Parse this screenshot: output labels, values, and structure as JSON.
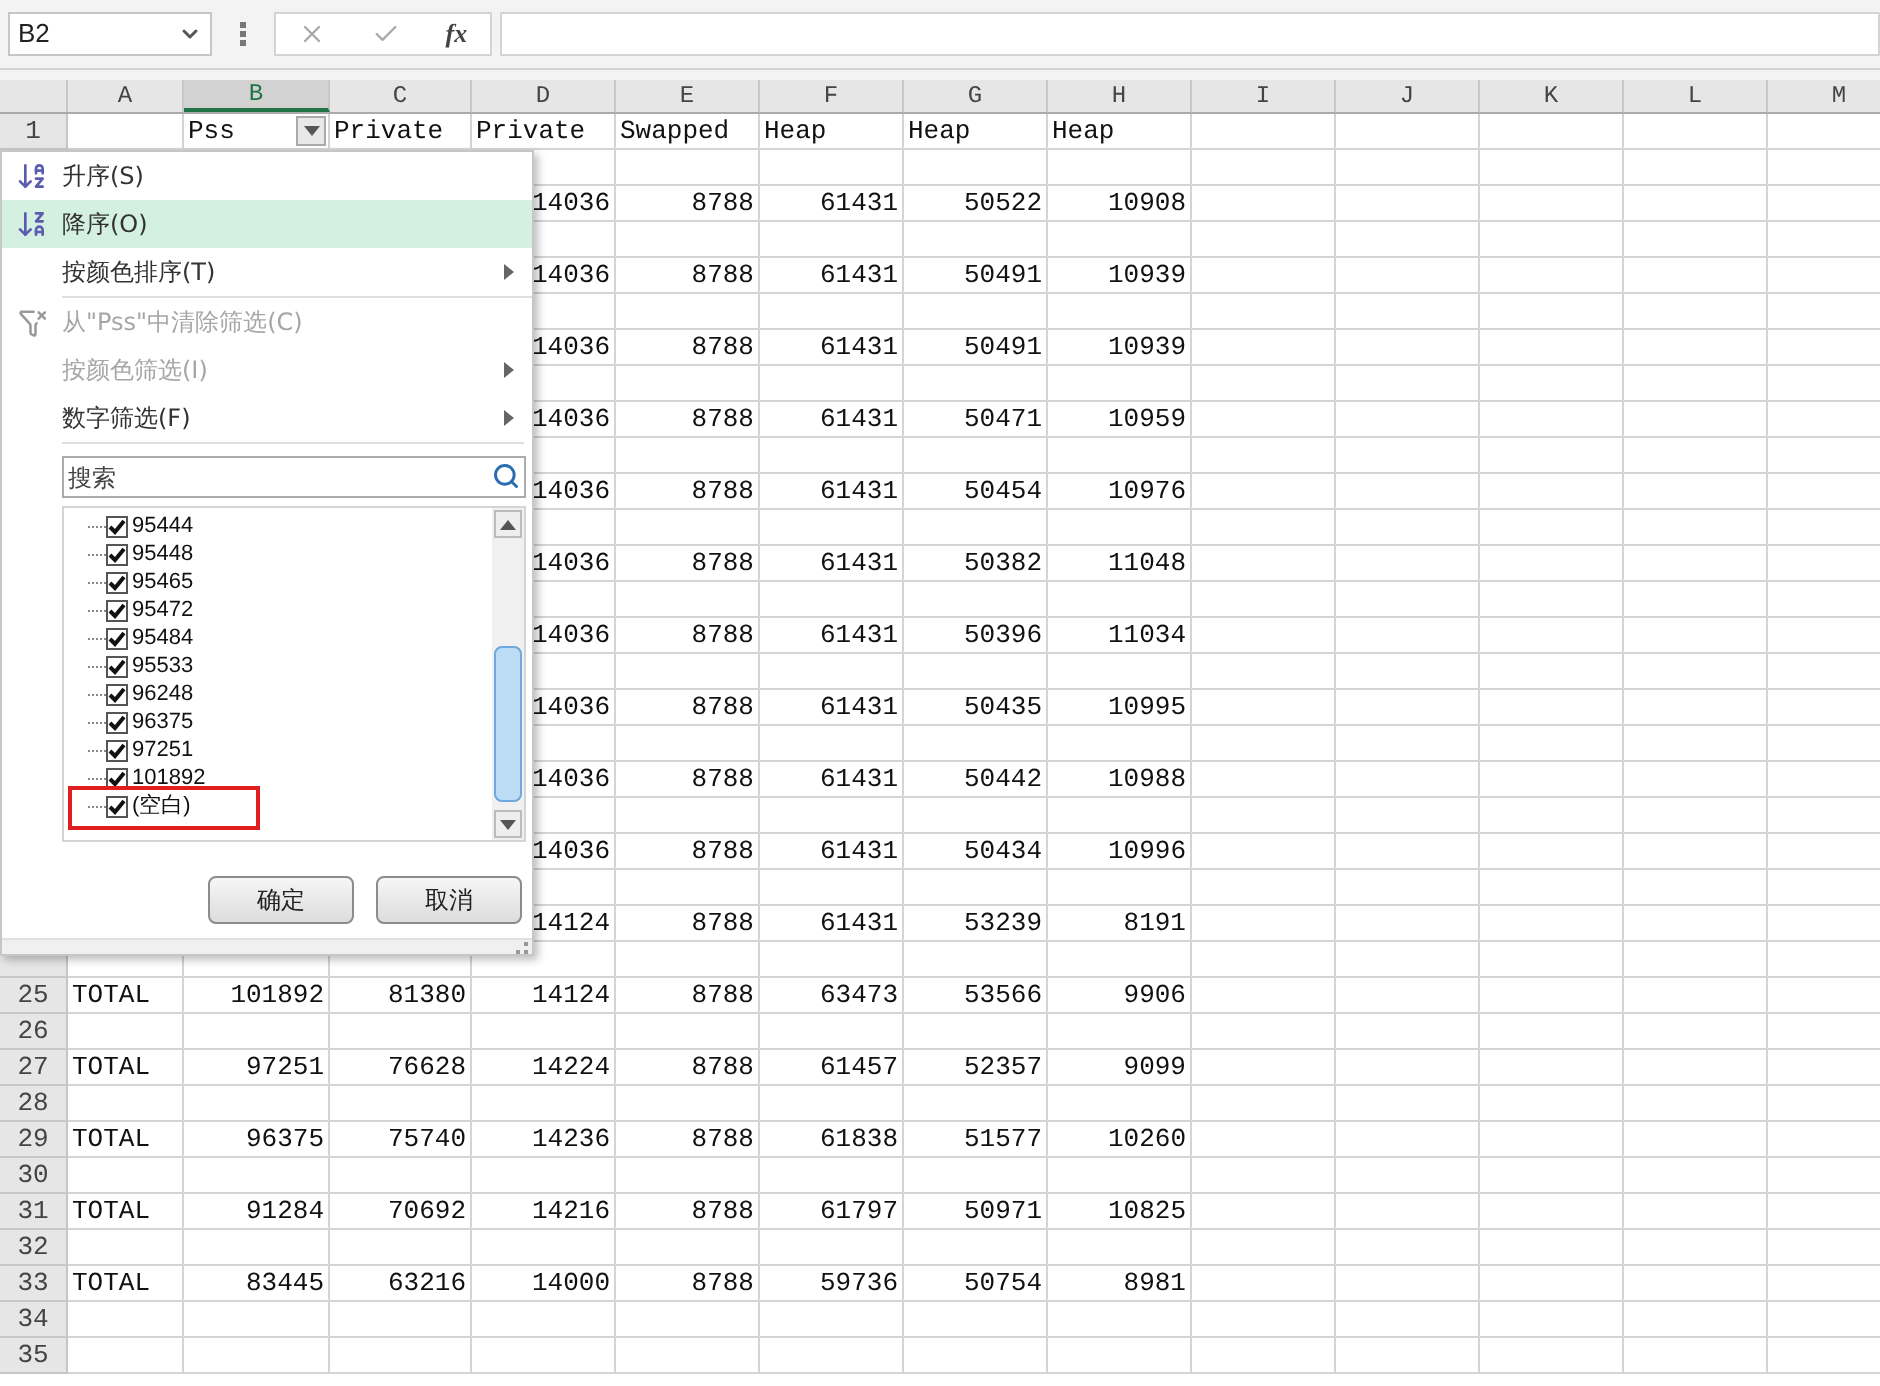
{
  "formula_bar": {
    "name_box": "B2",
    "function_label": "fx"
  },
  "sheet": {
    "columns": [
      {
        "letter": "A",
        "selected": false,
        "filter": false
      },
      {
        "letter": "B",
        "selected": true,
        "filter": true
      },
      {
        "letter": "C",
        "selected": false,
        "filter": false
      },
      {
        "letter": "D",
        "selected": false,
        "filter": false
      },
      {
        "letter": "E",
        "selected": false,
        "filter": false
      },
      {
        "letter": "F",
        "selected": false,
        "filter": false
      },
      {
        "letter": "G",
        "selected": false,
        "filter": false
      },
      {
        "letter": "H",
        "selected": false,
        "filter": false
      },
      {
        "letter": "I",
        "selected": false,
        "filter": false
      },
      {
        "letter": "J",
        "selected": false,
        "filter": false
      },
      {
        "letter": "K",
        "selected": false,
        "filter": false
      },
      {
        "letter": "L",
        "selected": false,
        "filter": false
      },
      {
        "letter": "M",
        "selected": false,
        "filter": false
      }
    ],
    "rows": [
      {
        "num": "1",
        "kind": "labels",
        "cells": {
          "B": "Pss",
          "C": "Private",
          "D": "Private",
          "E": "Swapped",
          "F": "Heap",
          "G": "Heap",
          "H": "Heap"
        }
      },
      {},
      {
        "cells": {
          "D": "14036",
          "E": "8788",
          "F": "61431",
          "G": "50522",
          "H": "10908"
        }
      },
      {},
      {
        "cells": {
          "D": "14036",
          "E": "8788",
          "F": "61431",
          "G": "50491",
          "H": "10939"
        }
      },
      {},
      {
        "cells": {
          "D": "14036",
          "E": "8788",
          "F": "61431",
          "G": "50491",
          "H": "10939"
        }
      },
      {},
      {
        "cells": {
          "D": "14036",
          "E": "8788",
          "F": "61431",
          "G": "50471",
          "H": "10959"
        }
      },
      {},
      {
        "cells": {
          "D": "14036",
          "E": "8788",
          "F": "61431",
          "G": "50454",
          "H": "10976"
        }
      },
      {},
      {
        "cells": {
          "D": "14036",
          "E": "8788",
          "F": "61431",
          "G": "50382",
          "H": "11048"
        }
      },
      {},
      {
        "cells": {
          "D": "14036",
          "E": "8788",
          "F": "61431",
          "G": "50396",
          "H": "11034"
        }
      },
      {},
      {
        "cells": {
          "D": "14036",
          "E": "8788",
          "F": "61431",
          "G": "50435",
          "H": "10995"
        }
      },
      {},
      {
        "cells": {
          "D": "14036",
          "E": "8788",
          "F": "61431",
          "G": "50442",
          "H": "10988"
        }
      },
      {},
      {
        "cells": {
          "D": "14036",
          "E": "8788",
          "F": "61431",
          "G": "50434",
          "H": "10996"
        }
      },
      {},
      {
        "cells": {
          "D": "14124",
          "E": "8788",
          "F": "61431",
          "G": "53239",
          "H": "8191"
        }
      },
      {},
      {
        "num": "25",
        "cells": {
          "A": "TOTAL",
          "B": "101892",
          "C": "81380",
          "D": "14124",
          "E": "8788",
          "F": "63473",
          "G": "53566",
          "H": "9906"
        }
      },
      {
        "num": "26"
      },
      {
        "num": "27",
        "cells": {
          "A": "TOTAL",
          "B": "97251",
          "C": "76628",
          "D": "14224",
          "E": "8788",
          "F": "61457",
          "G": "52357",
          "H": "9099"
        }
      },
      {
        "num": "28"
      },
      {
        "num": "29",
        "cells": {
          "A": "TOTAL",
          "B": "96375",
          "C": "75740",
          "D": "14236",
          "E": "8788",
          "F": "61838",
          "G": "51577",
          "H": "10260"
        }
      },
      {
        "num": "30"
      },
      {
        "num": "31",
        "cells": {
          "A": "TOTAL",
          "B": "91284",
          "C": "70692",
          "D": "14216",
          "E": "8788",
          "F": "61797",
          "G": "50971",
          "H": "10825"
        }
      },
      {
        "num": "32"
      },
      {
        "num": "33",
        "cells": {
          "A": "TOTAL",
          "B": "83445",
          "C": "63216",
          "D": "14000",
          "E": "8788",
          "F": "59736",
          "G": "50754",
          "H": "8981"
        }
      },
      {
        "num": "34"
      },
      {
        "num": "35"
      }
    ]
  },
  "filter_menu": {
    "groups": [
      [
        {
          "kind": "sort_asc",
          "label": "升序(S)",
          "highlighted": false,
          "disabled": false,
          "submenu": false
        },
        {
          "kind": "sort_desc",
          "label": "降序(O)",
          "highlighted": true,
          "disabled": false,
          "submenu": false
        },
        {
          "kind": "plain",
          "label": "按颜色排序(T)",
          "highlighted": false,
          "disabled": false,
          "submenu": true
        }
      ],
      [
        {
          "kind": "clear_filter",
          "label": "从\"Pss\"中清除筛选(C)",
          "highlighted": false,
          "disabled": true,
          "submenu": false
        },
        {
          "kind": "plain",
          "label": "按颜色筛选(I)",
          "highlighted": false,
          "disabled": true,
          "submenu": true
        },
        {
          "kind": "plain",
          "label": "数字筛选(F)",
          "highlighted": false,
          "disabled": false,
          "submenu": true
        }
      ]
    ],
    "search": {
      "placeholder": "搜索"
    },
    "values": [
      {
        "label": "95444",
        "checked": true,
        "annotated": false
      },
      {
        "label": "95448",
        "checked": true,
        "annotated": false
      },
      {
        "label": "95465",
        "checked": true,
        "annotated": false
      },
      {
        "label": "95472",
        "checked": true,
        "annotated": false
      },
      {
        "label": "95484",
        "checked": true,
        "annotated": false
      },
      {
        "label": "95533",
        "checked": true,
        "annotated": false
      },
      {
        "label": "96248",
        "checked": true,
        "annotated": false
      },
      {
        "label": "96375",
        "checked": true,
        "annotated": false
      },
      {
        "label": "97251",
        "checked": true,
        "annotated": false
      },
      {
        "label": "101892",
        "checked": true,
        "annotated": false
      },
      {
        "label": "(空白)",
        "checked": true,
        "annotated": true
      }
    ],
    "buttons": [
      "确定",
      "取消"
    ]
  }
}
